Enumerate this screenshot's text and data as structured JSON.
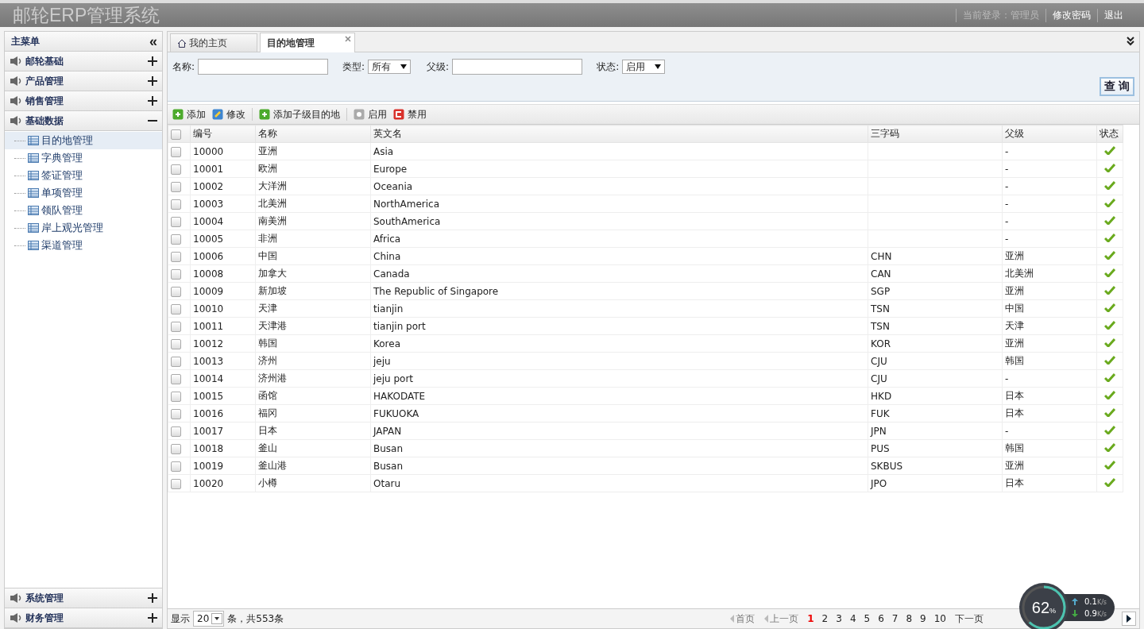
{
  "header": {
    "title": "邮轮ERP管理系统",
    "login_label": "当前登录：",
    "user": "管理员",
    "links": [
      "修改密码",
      "退出"
    ]
  },
  "sidebar": {
    "title": "主菜单",
    "collapse": "«",
    "groups_top": [
      {
        "label": "邮轮基础",
        "expanded": false
      },
      {
        "label": "产品管理",
        "expanded": false
      },
      {
        "label": "销售管理",
        "expanded": false
      },
      {
        "label": "基础数据",
        "expanded": true,
        "children": [
          {
            "label": "目的地管理",
            "selected": true
          },
          {
            "label": "字典管理",
            "selected": false
          },
          {
            "label": "签证管理",
            "selected": false
          },
          {
            "label": "单项管理",
            "selected": false
          },
          {
            "label": "领队管理",
            "selected": false
          },
          {
            "label": "岸上观光管理",
            "selected": false
          },
          {
            "label": "渠道管理",
            "selected": false
          }
        ]
      }
    ],
    "groups_bottom": [
      {
        "label": "系统管理",
        "expanded": false
      },
      {
        "label": "财务管理",
        "expanded": false
      }
    ]
  },
  "tabs": [
    {
      "label": "我的主页",
      "selected": false,
      "kind": "home"
    },
    {
      "label": "目的地管理",
      "selected": true,
      "kind": "closable"
    }
  ],
  "search": {
    "fields": [
      {
        "label": "名称:",
        "kind": "text"
      },
      {
        "label": "类型:",
        "kind": "select",
        "value": "所有"
      },
      {
        "label": "父级:",
        "kind": "text"
      },
      {
        "label": "状态:",
        "kind": "select",
        "value": "启用"
      }
    ],
    "button": "查 询"
  },
  "toolbar": [
    {
      "label": "添加",
      "kind": "add"
    },
    {
      "label": "修改",
      "kind": "edit"
    },
    {
      "label": "添加子级目的地",
      "kind": "add"
    },
    {
      "label": "启用",
      "kind": "enable"
    },
    {
      "label": "禁用",
      "kind": "disable"
    }
  ],
  "table": {
    "all_checked": false,
    "columns": [
      "编号",
      "名称",
      "英文名",
      "三字码",
      "父级",
      "状态"
    ],
    "rows": [
      {
        "id": "10000",
        "name": "亚洲",
        "en": "Asia",
        "code": "",
        "parent": "-",
        "enabled": true,
        "checked": false
      },
      {
        "id": "10001",
        "name": "欧洲",
        "en": "Europe",
        "code": "",
        "parent": "-",
        "enabled": true,
        "checked": false
      },
      {
        "id": "10002",
        "name": "大洋洲",
        "en": "Oceania",
        "code": "",
        "parent": "-",
        "enabled": true,
        "checked": false
      },
      {
        "id": "10003",
        "name": "北美洲",
        "en": "NorthAmerica",
        "code": "",
        "parent": "-",
        "enabled": true,
        "checked": false
      },
      {
        "id": "10004",
        "name": "南美洲",
        "en": "SouthAmerica",
        "code": "",
        "parent": "-",
        "enabled": true,
        "checked": false
      },
      {
        "id": "10005",
        "name": "非洲",
        "en": "Africa",
        "code": "",
        "parent": "-",
        "enabled": true,
        "checked": false
      },
      {
        "id": "10006",
        "name": "中国",
        "en": "China",
        "code": "CHN",
        "parent": "亚洲",
        "enabled": true,
        "checked": false
      },
      {
        "id": "10008",
        "name": "加拿大",
        "en": "Canada",
        "code": "CAN",
        "parent": "北美洲",
        "enabled": true,
        "checked": false
      },
      {
        "id": "10009",
        "name": "新加坡",
        "en": "The Republic of Singapore",
        "code": "SGP",
        "parent": "亚洲",
        "enabled": true,
        "checked": false
      },
      {
        "id": "10010",
        "name": "天津",
        "en": "tianjin",
        "code": "TSN",
        "parent": "中国",
        "enabled": true,
        "checked": false
      },
      {
        "id": "10011",
        "name": "天津港",
        "en": "tianjin port",
        "code": "TSN",
        "parent": "天津",
        "enabled": true,
        "checked": false
      },
      {
        "id": "10012",
        "name": "韩国",
        "en": "Korea",
        "code": "KOR",
        "parent": "亚洲",
        "enabled": true,
        "checked": false
      },
      {
        "id": "10013",
        "name": "济州",
        "en": "jeju",
        "code": "CJU",
        "parent": "韩国",
        "enabled": true,
        "checked": false
      },
      {
        "id": "10014",
        "name": "济州港",
        "en": "jeju port",
        "code": "CJU",
        "parent": "-",
        "enabled": true,
        "checked": false
      },
      {
        "id": "10015",
        "name": "函馆",
        "en": "HAKODATE",
        "code": "HKD",
        "parent": "日本",
        "enabled": true,
        "checked": false
      },
      {
        "id": "10016",
        "name": "福冈",
        "en": "FUKUOKA",
        "code": "FUK",
        "parent": "日本",
        "enabled": true,
        "checked": false
      },
      {
        "id": "10017",
        "name": "日本",
        "en": "JAPAN",
        "code": "JPN",
        "parent": "-",
        "enabled": true,
        "checked": false
      },
      {
        "id": "10018",
        "name": "釜山",
        "en": "Busan",
        "code": "PUS",
        "parent": "韩国",
        "enabled": true,
        "checked": false
      },
      {
        "id": "10019",
        "name": "釜山港",
        "en": "Busan",
        "code": "SKBUS",
        "parent": "亚洲",
        "enabled": true,
        "checked": false
      },
      {
        "id": "10020",
        "name": "小樽",
        "en": "Otaru",
        "code": "JPO",
        "parent": "日本",
        "enabled": true,
        "checked": false
      }
    ]
  },
  "footer": {
    "show": "显示",
    "page_size": "20",
    "total": "条，共553条",
    "first": "首页",
    "prev": "上一页",
    "pages": [
      {
        "label": "1",
        "selected": true
      },
      {
        "label": "2",
        "selected": false
      },
      {
        "label": "3",
        "selected": false
      },
      {
        "label": "4",
        "selected": false
      },
      {
        "label": "5",
        "selected": false
      },
      {
        "label": "6",
        "selected": false
      },
      {
        "label": "7",
        "selected": false
      },
      {
        "label": "8",
        "selected": false
      },
      {
        "label": "9",
        "selected": false
      },
      {
        "label": "10",
        "selected": false
      }
    ],
    "next": "下一页"
  },
  "speed_widget": {
    "percent": "62",
    "unit": "%",
    "level": 0.62,
    "up": "0.1",
    "up_unit": "K/s",
    "down": "0.9",
    "down_unit": "K/s"
  }
}
